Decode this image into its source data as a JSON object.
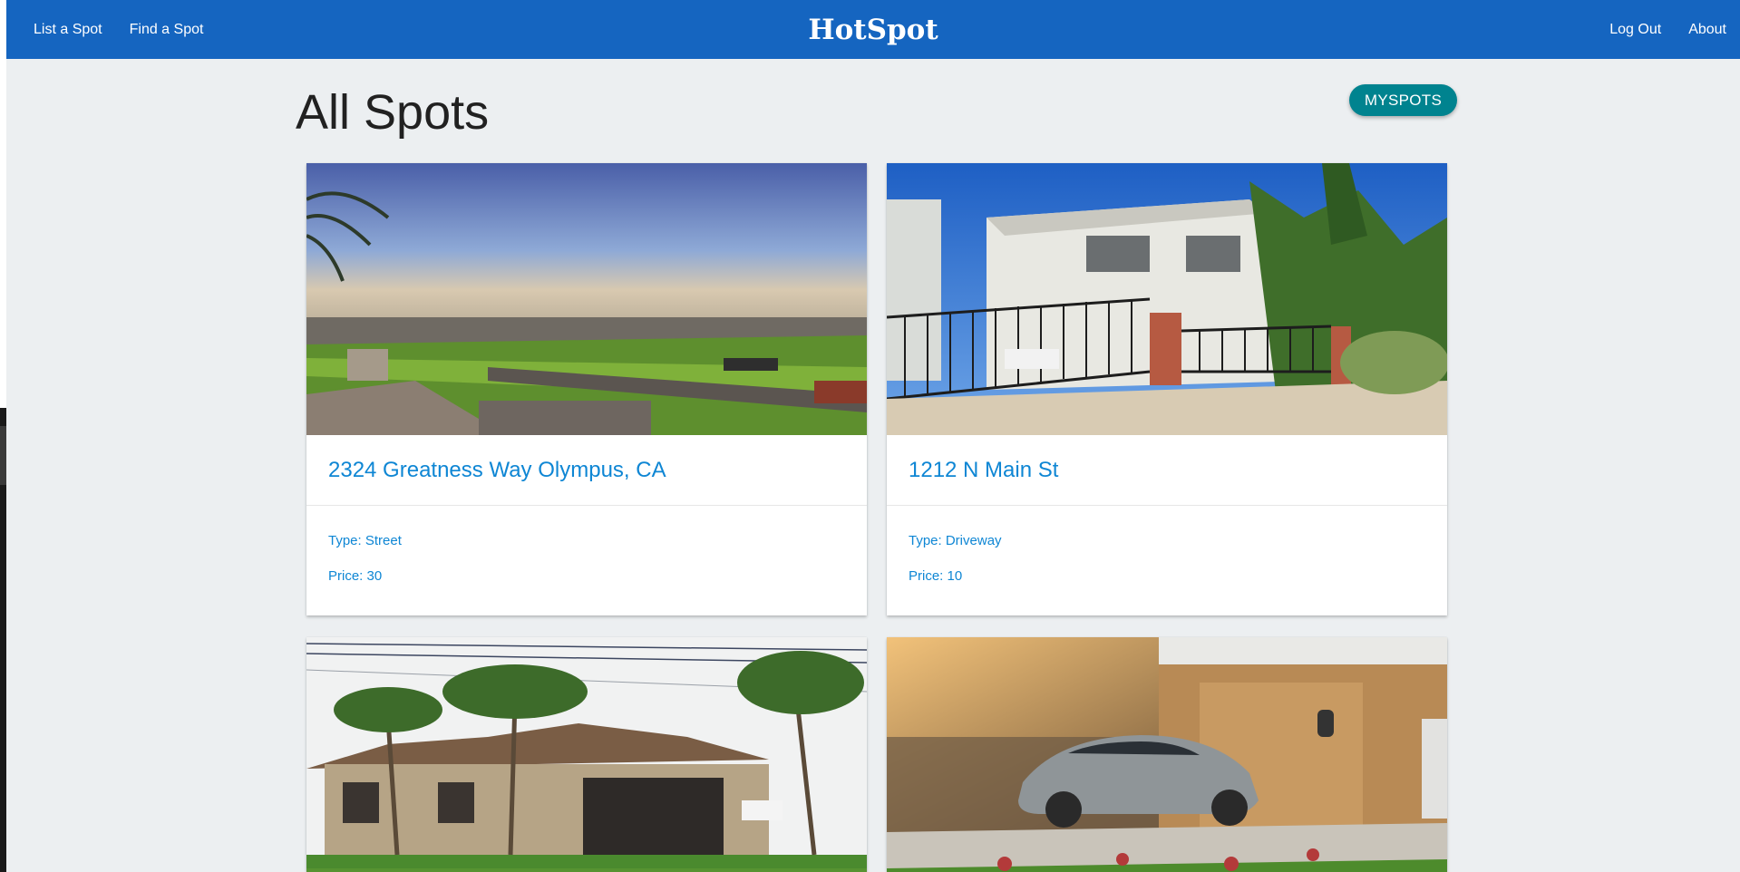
{
  "nav": {
    "left_links": [
      "List a Spot",
      "Find a Spot"
    ],
    "brand": "HotSpot",
    "right_links": [
      "Log Out",
      "About"
    ]
  },
  "page": {
    "title": "All Spots",
    "myspots_button": "MYSPOTS"
  },
  "spots": [
    {
      "address": "2324 Greatness Way Olympus, CA",
      "type": "Type: Street",
      "price": "Price: 30",
      "photo": "hillside-street-view"
    },
    {
      "address": "1212 N Main St",
      "type": "Type: Driveway",
      "price": "Price: 10",
      "photo": "house-with-gated-driveway"
    },
    {
      "photo": "house-with-palm-trees"
    },
    {
      "photo": "car-in-garage-driveway"
    }
  ],
  "colors": {
    "navbar": "#1565c0",
    "background": "#eceff1",
    "accent_button": "#00838f",
    "link_blue": "#0e86d4"
  }
}
